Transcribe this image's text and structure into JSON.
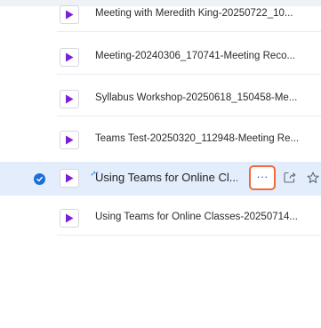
{
  "files": {
    "items": [
      {
        "name": "Meeting with Meredith King-20250722_10...",
        "selected": false
      },
      {
        "name": "Meeting-20240306_170741-Meeting Reco...",
        "selected": false
      },
      {
        "name": "Syllabus Workshop-20250618_150458-Me...",
        "selected": false
      },
      {
        "name": "Teams Test-20250320_112948-Meeting Re...",
        "selected": false
      },
      {
        "name": "Using Teams for Online Cl...",
        "selected": true
      },
      {
        "name": "Using Teams for Online Classes-20250714...",
        "selected": false
      }
    ]
  },
  "row_actions": {
    "more_label": "···",
    "more_icon": "more-horizontal-icon",
    "share_icon": "share-icon",
    "favorite_icon": "star-icon"
  },
  "colors": {
    "selected_row_bg": "#e3edfb",
    "check_blue": "#1b6fd6",
    "video_purple": "#7a1fd6",
    "focus_orange": "#f06a3a"
  }
}
